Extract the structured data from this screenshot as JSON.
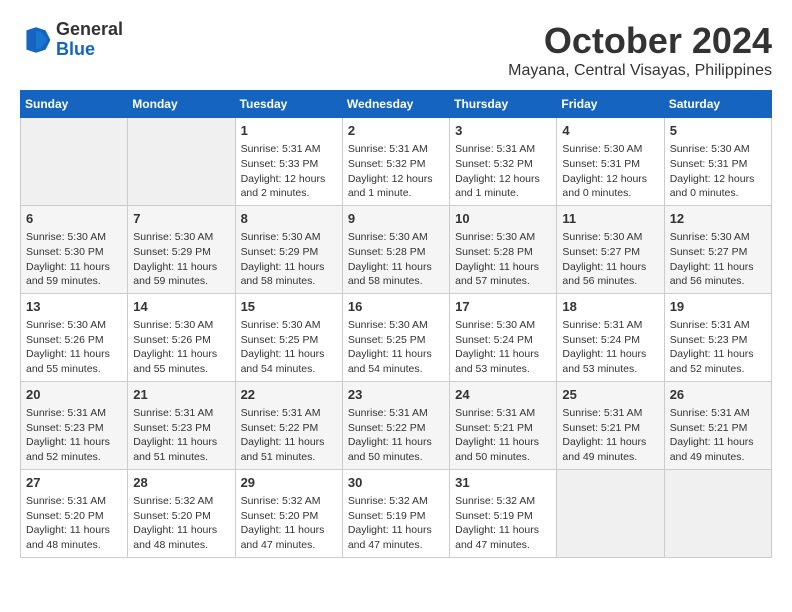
{
  "logo": {
    "line1": "General",
    "line2": "Blue"
  },
  "title": "October 2024",
  "location": "Mayana, Central Visayas, Philippines",
  "days_of_week": [
    "Sunday",
    "Monday",
    "Tuesday",
    "Wednesday",
    "Thursday",
    "Friday",
    "Saturday"
  ],
  "weeks": [
    [
      {
        "day": "",
        "empty": true
      },
      {
        "day": "",
        "empty": true
      },
      {
        "day": "1",
        "sunrise": "Sunrise: 5:31 AM",
        "sunset": "Sunset: 5:33 PM",
        "daylight": "Daylight: 12 hours and 2 minutes."
      },
      {
        "day": "2",
        "sunrise": "Sunrise: 5:31 AM",
        "sunset": "Sunset: 5:32 PM",
        "daylight": "Daylight: 12 hours and 1 minute."
      },
      {
        "day": "3",
        "sunrise": "Sunrise: 5:31 AM",
        "sunset": "Sunset: 5:32 PM",
        "daylight": "Daylight: 12 hours and 1 minute."
      },
      {
        "day": "4",
        "sunrise": "Sunrise: 5:30 AM",
        "sunset": "Sunset: 5:31 PM",
        "daylight": "Daylight: 12 hours and 0 minutes."
      },
      {
        "day": "5",
        "sunrise": "Sunrise: 5:30 AM",
        "sunset": "Sunset: 5:31 PM",
        "daylight": "Daylight: 12 hours and 0 minutes."
      }
    ],
    [
      {
        "day": "6",
        "sunrise": "Sunrise: 5:30 AM",
        "sunset": "Sunset: 5:30 PM",
        "daylight": "Daylight: 11 hours and 59 minutes."
      },
      {
        "day": "7",
        "sunrise": "Sunrise: 5:30 AM",
        "sunset": "Sunset: 5:29 PM",
        "daylight": "Daylight: 11 hours and 59 minutes."
      },
      {
        "day": "8",
        "sunrise": "Sunrise: 5:30 AM",
        "sunset": "Sunset: 5:29 PM",
        "daylight": "Daylight: 11 hours and 58 minutes."
      },
      {
        "day": "9",
        "sunrise": "Sunrise: 5:30 AM",
        "sunset": "Sunset: 5:28 PM",
        "daylight": "Daylight: 11 hours and 58 minutes."
      },
      {
        "day": "10",
        "sunrise": "Sunrise: 5:30 AM",
        "sunset": "Sunset: 5:28 PM",
        "daylight": "Daylight: 11 hours and 57 minutes."
      },
      {
        "day": "11",
        "sunrise": "Sunrise: 5:30 AM",
        "sunset": "Sunset: 5:27 PM",
        "daylight": "Daylight: 11 hours and 56 minutes."
      },
      {
        "day": "12",
        "sunrise": "Sunrise: 5:30 AM",
        "sunset": "Sunset: 5:27 PM",
        "daylight": "Daylight: 11 hours and 56 minutes."
      }
    ],
    [
      {
        "day": "13",
        "sunrise": "Sunrise: 5:30 AM",
        "sunset": "Sunset: 5:26 PM",
        "daylight": "Daylight: 11 hours and 55 minutes."
      },
      {
        "day": "14",
        "sunrise": "Sunrise: 5:30 AM",
        "sunset": "Sunset: 5:26 PM",
        "daylight": "Daylight: 11 hours and 55 minutes."
      },
      {
        "day": "15",
        "sunrise": "Sunrise: 5:30 AM",
        "sunset": "Sunset: 5:25 PM",
        "daylight": "Daylight: 11 hours and 54 minutes."
      },
      {
        "day": "16",
        "sunrise": "Sunrise: 5:30 AM",
        "sunset": "Sunset: 5:25 PM",
        "daylight": "Daylight: 11 hours and 54 minutes."
      },
      {
        "day": "17",
        "sunrise": "Sunrise: 5:30 AM",
        "sunset": "Sunset: 5:24 PM",
        "daylight": "Daylight: 11 hours and 53 minutes."
      },
      {
        "day": "18",
        "sunrise": "Sunrise: 5:31 AM",
        "sunset": "Sunset: 5:24 PM",
        "daylight": "Daylight: 11 hours and 53 minutes."
      },
      {
        "day": "19",
        "sunrise": "Sunrise: 5:31 AM",
        "sunset": "Sunset: 5:23 PM",
        "daylight": "Daylight: 11 hours and 52 minutes."
      }
    ],
    [
      {
        "day": "20",
        "sunrise": "Sunrise: 5:31 AM",
        "sunset": "Sunset: 5:23 PM",
        "daylight": "Daylight: 11 hours and 52 minutes."
      },
      {
        "day": "21",
        "sunrise": "Sunrise: 5:31 AM",
        "sunset": "Sunset: 5:23 PM",
        "daylight": "Daylight: 11 hours and 51 minutes."
      },
      {
        "day": "22",
        "sunrise": "Sunrise: 5:31 AM",
        "sunset": "Sunset: 5:22 PM",
        "daylight": "Daylight: 11 hours and 51 minutes."
      },
      {
        "day": "23",
        "sunrise": "Sunrise: 5:31 AM",
        "sunset": "Sunset: 5:22 PM",
        "daylight": "Daylight: 11 hours and 50 minutes."
      },
      {
        "day": "24",
        "sunrise": "Sunrise: 5:31 AM",
        "sunset": "Sunset: 5:21 PM",
        "daylight": "Daylight: 11 hours and 50 minutes."
      },
      {
        "day": "25",
        "sunrise": "Sunrise: 5:31 AM",
        "sunset": "Sunset: 5:21 PM",
        "daylight": "Daylight: 11 hours and 49 minutes."
      },
      {
        "day": "26",
        "sunrise": "Sunrise: 5:31 AM",
        "sunset": "Sunset: 5:21 PM",
        "daylight": "Daylight: 11 hours and 49 minutes."
      }
    ],
    [
      {
        "day": "27",
        "sunrise": "Sunrise: 5:31 AM",
        "sunset": "Sunset: 5:20 PM",
        "daylight": "Daylight: 11 hours and 48 minutes."
      },
      {
        "day": "28",
        "sunrise": "Sunrise: 5:32 AM",
        "sunset": "Sunset: 5:20 PM",
        "daylight": "Daylight: 11 hours and 48 minutes."
      },
      {
        "day": "29",
        "sunrise": "Sunrise: 5:32 AM",
        "sunset": "Sunset: 5:20 PM",
        "daylight": "Daylight: 11 hours and 47 minutes."
      },
      {
        "day": "30",
        "sunrise": "Sunrise: 5:32 AM",
        "sunset": "Sunset: 5:19 PM",
        "daylight": "Daylight: 11 hours and 47 minutes."
      },
      {
        "day": "31",
        "sunrise": "Sunrise: 5:32 AM",
        "sunset": "Sunset: 5:19 PM",
        "daylight": "Daylight: 11 hours and 47 minutes."
      },
      {
        "day": "",
        "empty": true
      },
      {
        "day": "",
        "empty": true
      }
    ]
  ]
}
